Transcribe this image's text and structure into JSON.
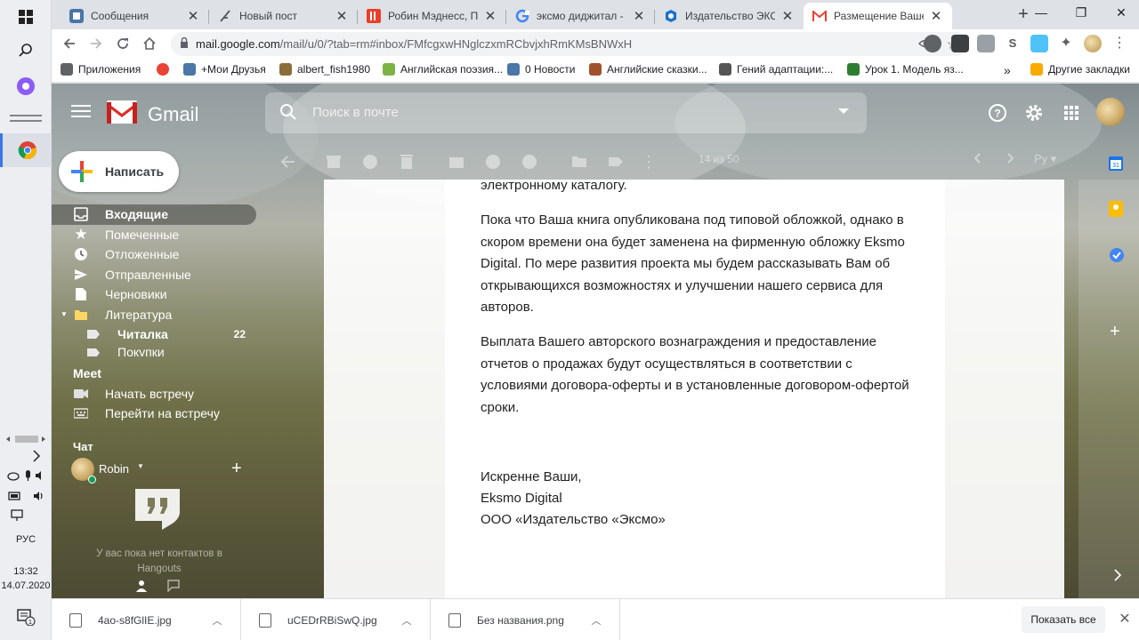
{
  "taskbar": {
    "clock_time": "13:32",
    "clock_date": "14.07.2020",
    "lang": "РУС",
    "notification_count": "1"
  },
  "tabs": [
    {
      "title": "Сообщения",
      "icon": "vk-icon",
      "color": "#4a76a8",
      "active": false
    },
    {
      "title": "Новый пост",
      "icon": "feather-icon",
      "color": "#555555",
      "active": false
    },
    {
      "title": "Робин Мэднесс, Про",
      "icon": "litres-icon",
      "color": "#e8402c",
      "active": false
    },
    {
      "title": "эксмо диджитал - По",
      "icon": "google-icon",
      "color": "#4285f4",
      "active": false
    },
    {
      "title": "Издательство ЭКСМО",
      "icon": "eksmo-icon",
      "color": "#1a73c8",
      "active": false
    },
    {
      "title": "Размещение Вашей",
      "icon": "gmail-icon",
      "color": "#ea4335",
      "active": true
    }
  ],
  "address_bar": {
    "host": "mail.google.com",
    "path": "/mail/u/0/?tab=rm#inbox/FMfcgxwHNglczxmRCbvjxhRmKMsBNWxH"
  },
  "bookmarks": [
    {
      "label": "Приложения",
      "color": "#5f6368"
    },
    {
      "label": "",
      "color": "#ea4335"
    },
    {
      "label": "+Мои Друзья",
      "color": "#4a76a8"
    },
    {
      "label": "albert_fish1980",
      "color": "#8a6d3b"
    },
    {
      "label": "Английская поэзия...",
      "color": "#7cb342"
    },
    {
      "label": "0 Новости",
      "color": "#4a76a8"
    },
    {
      "label": "Английские сказки...",
      "color": "#a0522d"
    },
    {
      "label": "Гений адаптации:...",
      "color": "#555555"
    },
    {
      "label": "Урок 1. Модель яз...",
      "color": "#2e7d32"
    },
    {
      "label": "Другие закладки",
      "color": "#f9ab00"
    }
  ],
  "gmail": {
    "app_name": "Gmail",
    "search_placeholder": "Поиск в почте",
    "compose_label": "Написать",
    "pager": "14 из 50",
    "lang_selector": "Ру",
    "nav": [
      {
        "label": "Входящие",
        "icon": "inbox-icon",
        "active": true,
        "count": ""
      },
      {
        "label": "Помеченные",
        "icon": "star-icon",
        "active": false,
        "count": ""
      },
      {
        "label": "Отложенные",
        "icon": "clock-icon",
        "active": false,
        "count": ""
      },
      {
        "label": "Отправленные",
        "icon": "send-icon",
        "active": false,
        "count": ""
      },
      {
        "label": "Черновики",
        "icon": "draft-icon",
        "active": false,
        "count": ""
      },
      {
        "label": "Литература",
        "icon": "folder-icon",
        "active": false,
        "count": ""
      },
      {
        "label": "Читалка",
        "icon": "label-icon",
        "active": false,
        "count": "22"
      },
      {
        "label": "Покупки",
        "icon": "label-icon",
        "active": false,
        "count": ""
      }
    ],
    "meet": {
      "title": "Meet",
      "start": "Начать встречу",
      "join": "Перейти на встречу"
    },
    "chat": {
      "title": "Чат",
      "user": "Robin",
      "empty_text": "У вас пока нет контактов в Hangouts"
    }
  },
  "message": {
    "paragraphs": [
      "электронному каталогу.",
      "Пока что Ваша книга опубликована под типовой обложкой, однако в скором времени она будет заменена на фирменную обложку Eksmo Digital. По мере развития проекта мы будем рассказывать Вам об открывающихся возможностях и улучшении нашего сервиса для авторов.",
      "Выплата Вашего авторского вознаграждения и предоставление отчетов о продажах будут осуществляться в соответствии с условиями договора-оферты и в установленные договором-офертой сроки."
    ],
    "signoff": "Искренне Ваши,",
    "sender": "Eksmo Digital",
    "company": "ООО «Издательство «Эксмо»"
  },
  "downloads": {
    "files": [
      "4ao-s8fGlIE.jpg",
      "uCEDrRBiSwQ.jpg",
      "Без названия.png"
    ],
    "show_all": "Показать все"
  }
}
